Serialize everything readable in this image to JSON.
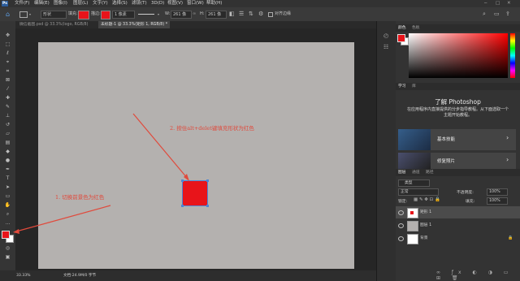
{
  "menubar": {
    "logo": "Ps",
    "items": [
      "文件(F)",
      "编辑(E)",
      "图像(I)",
      "图层(L)",
      "文字(Y)",
      "选择(S)",
      "滤镜(T)",
      "3D(D)",
      "视图(V)",
      "窗口(W)",
      "帮助(H)"
    ]
  },
  "options": {
    "mode": "形状",
    "fill_label": "填充:",
    "stroke_label": "描边:",
    "stroke_width": "1 像素",
    "w_label": "W:",
    "w_value": "261 像",
    "h_label": "H:",
    "h_value": "261 像",
    "align_edges": "对齐边缘",
    "fill_color": "#e8141a",
    "stroke_color": "#e8141a"
  },
  "tabs": [
    {
      "label": "微信截图.psd @ 33.3%(logo, RGB/8)"
    },
    {
      "label": "未标题-1 @ 33.3%(矩形 1, RGB/8) *",
      "active": true
    }
  ],
  "statusbar": {
    "zoom": "33.33%",
    "doc": "文档:24.9M/0 字节"
  },
  "annotations": {
    "step1": "1. 切换前景色为红色",
    "step2": "2. 按住alt+delet键填充形状为红色"
  },
  "colors": {
    "foreground": "#e8141a",
    "background": "#ffffff",
    "accent": "#e04a3c"
  },
  "color_panel": {
    "tabs": [
      "颜色",
      "色板"
    ]
  },
  "learn_panel": {
    "tabs": [
      "学习",
      "库"
    ],
    "title": "了解 Photoshop",
    "desc": "在应用程序内直接提供的分步指导教程。从下面选取一个主题开始教程。",
    "topics": [
      {
        "label": "基本技能"
      },
      {
        "label": "修复照片"
      }
    ]
  },
  "layers_panel": {
    "tabs": [
      "图层",
      "通道",
      "路径"
    ],
    "kind": "类型",
    "blend": "正常",
    "opacity_label": "不透明度:",
    "opacity": "100%",
    "lock_label": "锁定:",
    "fill_label": "填充:",
    "fill": "100%",
    "layers": [
      {
        "name": "矩形 1",
        "type": "shape"
      },
      {
        "name": "图层 1",
        "type": "pixel"
      },
      {
        "name": "背景",
        "type": "background"
      }
    ]
  }
}
